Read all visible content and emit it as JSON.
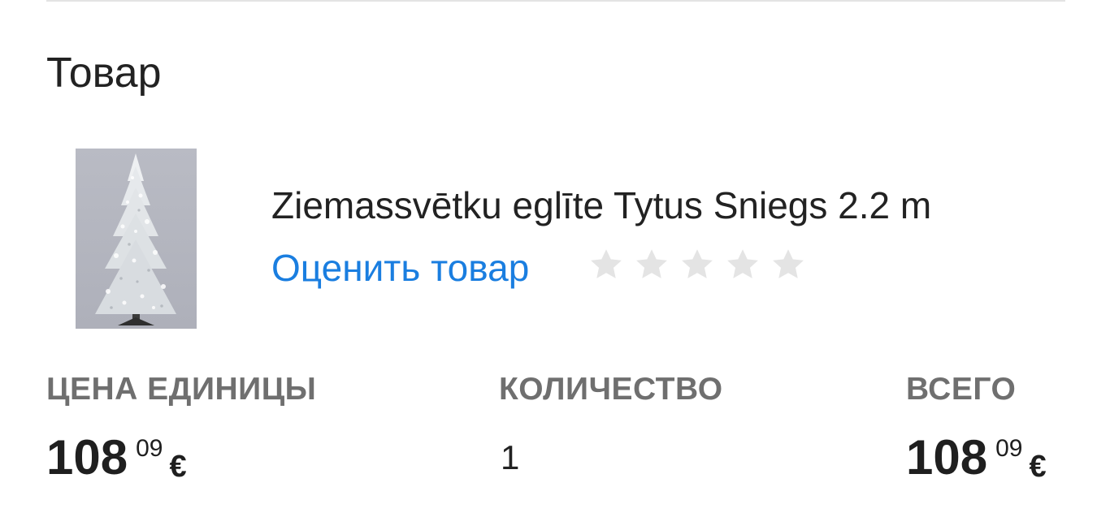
{
  "section": {
    "title": "Товар"
  },
  "product": {
    "name": "Ziemassvētku eglīte Tytus Sniegs 2.2 m",
    "image_icon": "christmas-tree-image",
    "rate_label": "Оценить товар",
    "rating": {
      "value": 0,
      "max": 5
    }
  },
  "columns": {
    "unit_price_label": "ЦЕНА ЕДИНИЦЫ",
    "quantity_label": "КОЛИЧЕСТВО",
    "total_label": "ВСЕГО"
  },
  "unit_price": {
    "whole": "108",
    "cents": "09",
    "currency": "€"
  },
  "quantity": "1",
  "total": {
    "whole": "108",
    "cents": "09",
    "currency": "€"
  },
  "colors": {
    "link": "#1a7ee0",
    "star_empty": "#e4e4e4",
    "label_gray": "#6f6f6f"
  }
}
